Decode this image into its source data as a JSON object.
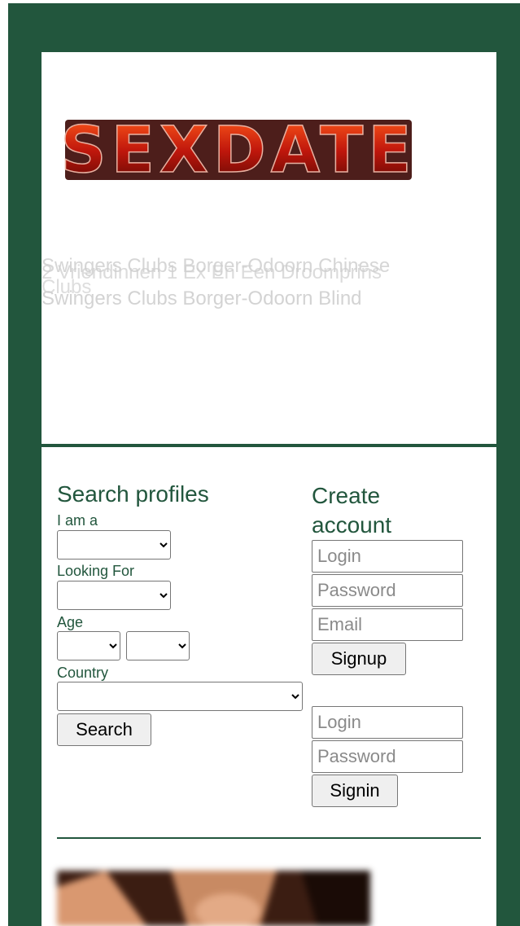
{
  "header": {
    "logo_text": "SEXDATE",
    "overlap_lines": [
      "Swingers Clubs Borger-Odoorn Chinese",
      "2 Vriendinnen 1 Ex En Een Droomprins",
      "Swingers Clubs Borger-Odoorn Blind",
      "Clubs"
    ]
  },
  "search": {
    "title": "Search profiles",
    "iam_label": "I am a",
    "looking_label": "Looking For",
    "age_label": "Age",
    "country_label": "Country",
    "search_button": "Search"
  },
  "create": {
    "title": "Create account",
    "login_placeholder": "Login",
    "password_placeholder": "Password",
    "email_placeholder": "Email",
    "signup_button": "Signup"
  },
  "signin": {
    "login_placeholder": "Login",
    "password_placeholder": "Password",
    "signin_button": "Signin"
  },
  "colors": {
    "frame": "#22563d",
    "accent": "#22563d"
  }
}
